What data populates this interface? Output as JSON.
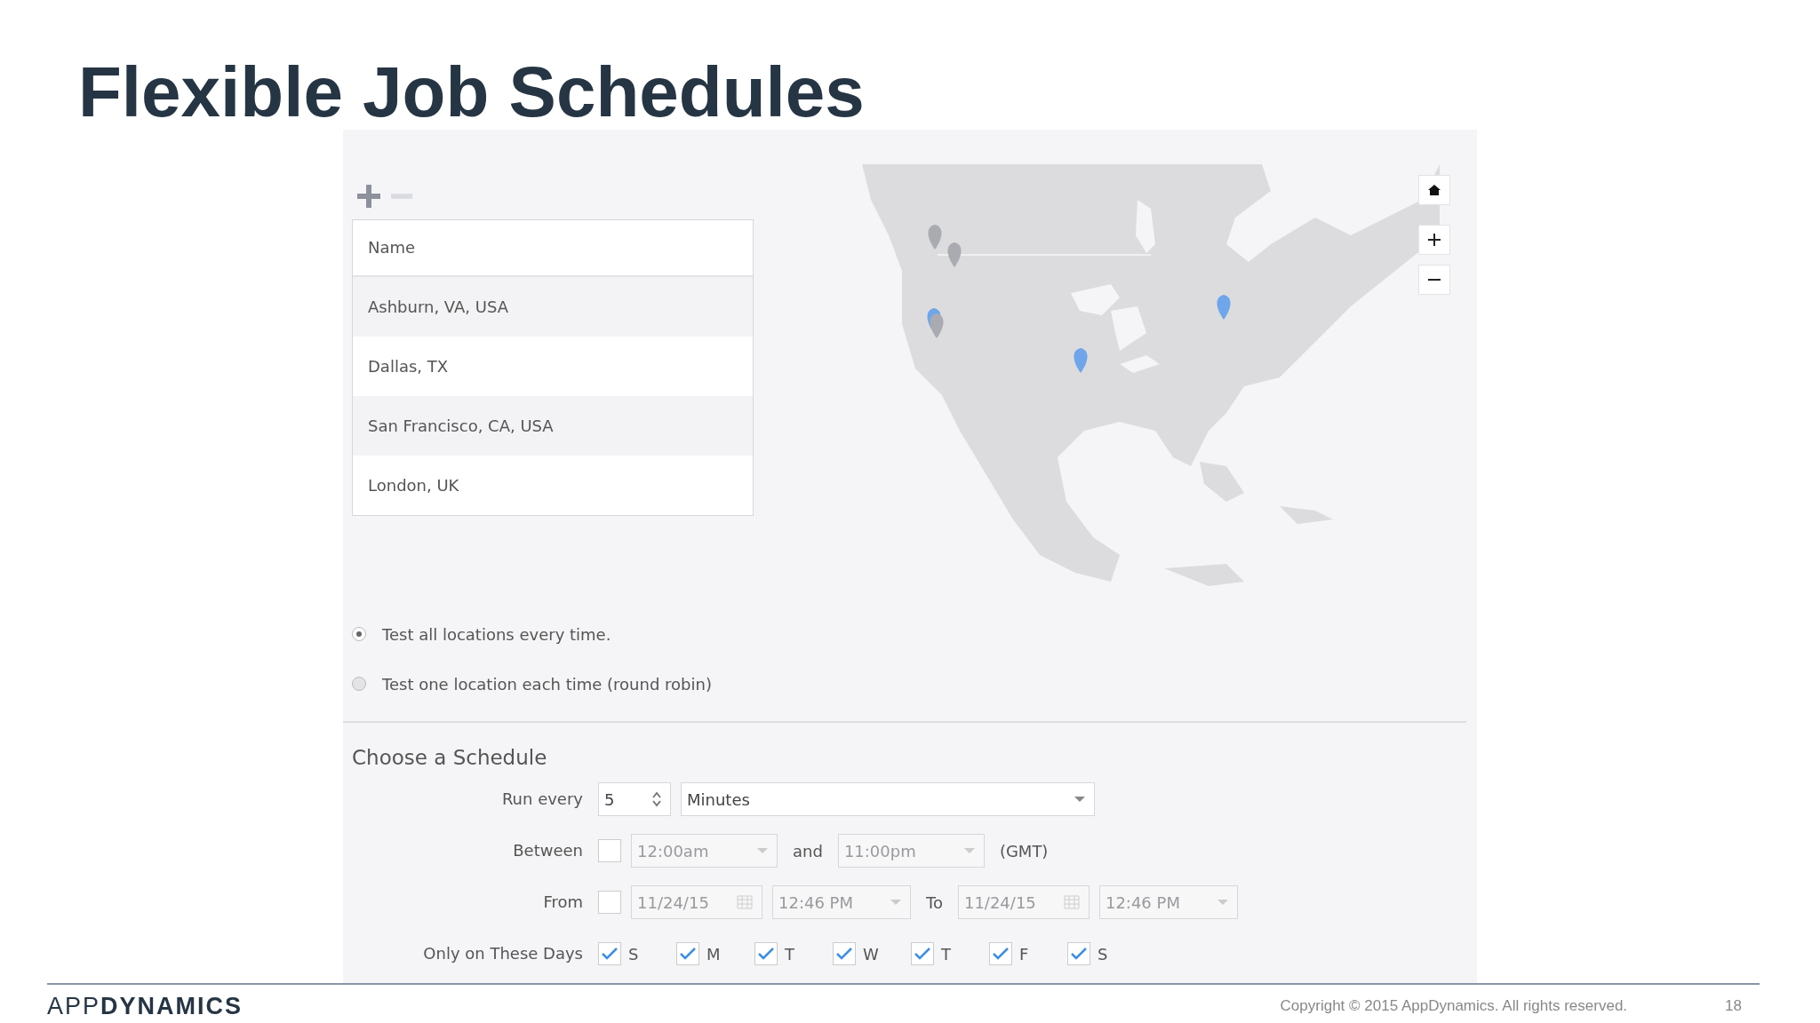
{
  "title": "Flexible Job Schedules",
  "table": {
    "columns": [
      "Name"
    ],
    "rows": [
      "Ashburn, VA, USA",
      "Dallas, TX",
      "San Francisco, CA, USA",
      "London, UK"
    ]
  },
  "test_mode": [
    {
      "label": "Test all locations every time.",
      "selected": true
    },
    {
      "label": "Test one location each time (round robin)",
      "selected": false
    }
  ],
  "schedule": {
    "heading": "Choose a Schedule",
    "run_every": {
      "label": "Run every",
      "value": "5",
      "unit": "Minutes"
    },
    "between": {
      "label": "Between",
      "checked": false,
      "start": "12:00am",
      "and_label": "and",
      "end": "11:00pm",
      "timezone": "(GMT)"
    },
    "from": {
      "label": "From",
      "checked": false,
      "start_date": "11/24/15",
      "start_time": "12:46 PM",
      "to_label": "To",
      "end_date": "11/24/15",
      "end_time": "12:46 PM"
    },
    "days": {
      "label": "Only on These Days",
      "items": [
        {
          "label": "S",
          "checked": true
        },
        {
          "label": "M",
          "checked": true
        },
        {
          "label": "T",
          "checked": true
        },
        {
          "label": "W",
          "checked": true
        },
        {
          "label": "T",
          "checked": true
        },
        {
          "label": "F",
          "checked": true
        },
        {
          "label": "S",
          "checked": true
        }
      ]
    }
  },
  "footer": {
    "logo": "APP**DYNAMICS**",
    "copyright": "Copyright © 2015 AppDynamics. All rights reserved.",
    "page": "18"
  }
}
